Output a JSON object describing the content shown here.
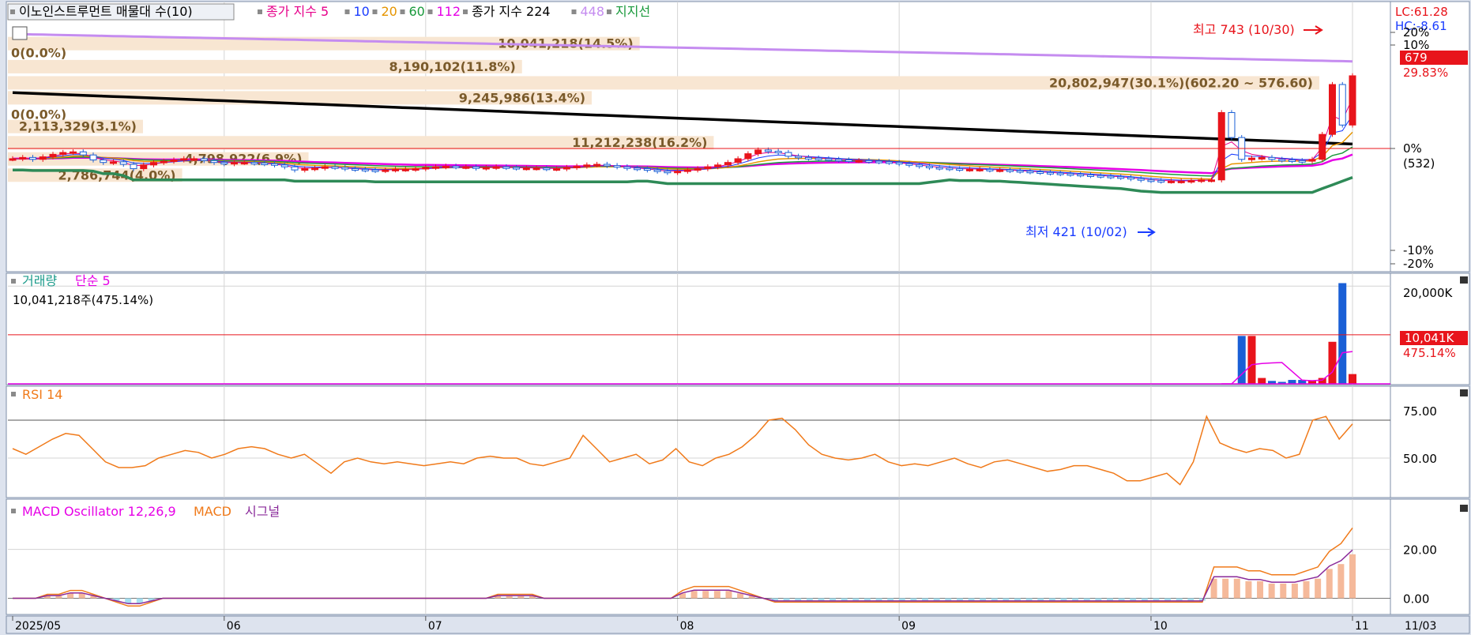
{
  "price_panel": {
    "header_items": [
      {
        "text": "이노인스트루먼트 매물대 수(10)",
        "color": "#000000",
        "boxed": true
      },
      {
        "text": "종가 지수 5",
        "color": "#e6008a"
      },
      {
        "text": "10",
        "color": "#1a3cff"
      },
      {
        "text": "20",
        "color": "#e69500"
      },
      {
        "text": "60",
        "color": "#1a9a3c"
      },
      {
        "text": "112",
        "color": "#e600e6"
      },
      {
        "text": "종가 지수 224",
        "color": "#000000"
      },
      {
        "text": "448",
        "color": "#c58cf0"
      },
      {
        "text": "지지선",
        "color": "#1a9a3c"
      }
    ],
    "lc_label": "LC:61.28",
    "hc_label": "HC:-8.61",
    "price_box_value": "679",
    "price_box_pct": "29.83%",
    "pct_axis_labels": [
      {
        "text": "20%",
        "value": 755
      },
      {
        "text": "10%",
        "value": 718
      },
      {
        "text": "0%",
        "value": 523
      },
      {
        "text": "-10%",
        "value": 398
      },
      {
        "text": "-20%",
        "value": 380
      }
    ],
    "axis_value_label": "(532)",
    "high_label": "최고 743 (10/30)",
    "low_label": "최저 421 (10/02)",
    "volume_profile": [
      {
        "label": "10,041,218(14.5%)",
        "pct": 14.5,
        "level": 730
      },
      {
        "label": "0(0.0%)",
        "pct": 0.0,
        "level": 715
      },
      {
        "label": "8,190,102(11.8%)",
        "pct": 11.8,
        "level": 693
      },
      {
        "label": "20,802,947(30.1%)(602.20 ~ 576.60)",
        "pct": 30.1,
        "level": 667
      },
      {
        "label": "9,245,986(13.4%)",
        "pct": 13.4,
        "level": 643
      },
      {
        "label": "0(0.0%)",
        "pct": 0.0,
        "level": 616
      },
      {
        "label": "2,113,329(3.1%)",
        "pct": 3.1,
        "level": 597
      },
      {
        "label": "11,212,238(16.2%)",
        "pct": 16.2,
        "level": 571
      },
      {
        "label": "4,798,922(6.9%)",
        "pct": 6.9,
        "level": 545
      },
      {
        "label": "2,786,744(4.0%)",
        "pct": 4.0,
        "level": 519
      }
    ]
  },
  "volume_panel": {
    "title": "거래량",
    "ma_label": "단순 5",
    "info": "10,041,218주(475.14%)",
    "axis_top": "20,000K",
    "last_value": "10,041K",
    "last_pct": "475.14%"
  },
  "rsi_panel": {
    "title": "RSI 14",
    "axis_labels": [
      "75.00",
      "50.00"
    ]
  },
  "macd_panel": {
    "title": "MACD Oscillator 12,26,9",
    "macd_label": "MACD",
    "signal_label": "시그널",
    "axis_labels": [
      "20.00",
      "0.00"
    ]
  },
  "x_axis": {
    "labels": [
      {
        "text": "2025/05",
        "index": 0
      },
      {
        "text": "06",
        "index": 21
      },
      {
        "text": "07",
        "index": 41
      },
      {
        "text": "08",
        "index": 66
      },
      {
        "text": "09",
        "index": 88
      },
      {
        "text": "10",
        "index": 113
      },
      {
        "text": "11",
        "index": 133
      }
    ],
    "end_label": "11/03"
  },
  "chart_data": {
    "type": "candlestick",
    "ohlc_close": [
      546,
      548,
      545,
      549,
      553,
      556,
      557,
      552,
      544,
      540,
      541,
      537,
      530,
      536,
      540,
      542,
      544,
      546,
      546,
      543,
      540,
      538,
      540,
      540,
      539,
      538,
      536,
      533,
      528,
      530,
      531,
      533,
      532,
      530,
      529,
      528,
      527,
      528,
      529,
      529,
      530,
      532,
      533,
      534,
      533,
      533,
      531,
      532,
      533,
      532,
      531,
      531,
      531,
      530,
      530,
      532,
      534,
      536,
      537,
      535,
      533,
      531,
      530,
      528,
      526,
      524,
      526,
      528,
      530,
      533,
      536,
      540,
      546,
      554,
      560,
      558,
      556,
      550,
      548,
      547,
      546,
      545,
      544,
      543,
      543,
      542,
      541,
      540,
      538,
      536,
      534,
      532,
      531,
      530,
      529,
      529,
      529,
      528,
      528,
      527,
      526,
      525,
      524,
      523,
      522,
      521,
      520,
      519,
      518,
      517,
      516,
      514,
      512,
      511,
      510,
      510,
      510,
      511,
      512,
      512,
      620,
      580,
      545,
      547,
      548,
      545,
      544,
      543,
      542,
      545,
      585,
      665,
      600,
      679
    ],
    "volume_k": [
      80,
      80,
      0,
      0,
      0,
      0,
      0,
      0,
      0,
      0,
      0,
      0,
      0,
      0,
      0,
      0,
      0,
      0,
      0,
      0,
      0,
      0,
      0,
      0,
      0,
      0,
      0,
      0,
      0,
      0,
      0,
      0,
      0,
      0,
      0,
      0,
      0,
      0,
      0,
      0,
      0,
      0,
      0,
      0,
      0,
      0,
      0,
      0,
      0,
      0,
      0,
      0,
      0,
      0,
      0,
      0,
      0,
      0,
      0,
      0,
      0,
      0,
      0,
      0,
      0,
      0,
      0,
      0,
      0,
      0,
      0,
      0,
      0,
      0,
      0,
      80,
      80,
      0,
      0,
      0,
      0,
      0,
      0,
      0,
      0,
      0,
      0,
      0,
      0,
      0,
      0,
      0,
      0,
      0,
      0,
      0,
      0,
      0,
      0,
      0,
      0,
      0,
      0,
      0,
      0,
      0,
      0,
      0,
      0,
      0,
      0,
      0,
      0,
      0,
      0,
      0,
      0,
      0,
      0,
      0,
      0,
      0,
      0,
      0,
      0,
      0,
      0,
      0,
      0,
      0,
      0,
      0,
      0,
      0,
      0,
      0,
      0,
      0,
      0,
      0,
      0,
      0,
      0,
      0
    ],
    "volume_last12_k": [
      9800,
      9800,
      1200,
      600,
      400,
      800,
      800,
      600,
      1200,
      8600,
      20600,
      2000
    ],
    "rsi": [
      55,
      52,
      56,
      60,
      63,
      62,
      55,
      48,
      45,
      45,
      46,
      50,
      52,
      54,
      53,
      50,
      52,
      55,
      56,
      55,
      52,
      50,
      52,
      47,
      42,
      48,
      50,
      48,
      47,
      48,
      47,
      46,
      47,
      48,
      47,
      50,
      51,
      50,
      50,
      47,
      46,
      48,
      50,
      62,
      55,
      48,
      50,
      52,
      47,
      49,
      55,
      48,
      46,
      50,
      52,
      56,
      62,
      70,
      71,
      65,
      57,
      52,
      50,
      49,
      50,
      52,
      48,
      46,
      47,
      46,
      48,
      50,
      47,
      45,
      48,
      49,
      47,
      45,
      43,
      44,
      46,
      46,
      44,
      42,
      38,
      38,
      40,
      42,
      36,
      48,
      72,
      58,
      55,
      53,
      55,
      54,
      50,
      52,
      70,
      72,
      60,
      68
    ],
    "macd_osc": [
      0,
      0,
      0,
      1,
      1,
      2,
      2,
      1,
      0,
      -1,
      -2,
      -2,
      -1,
      0,
      0,
      0,
      0,
      0,
      0,
      0,
      0,
      0,
      0,
      0,
      0,
      0,
      0,
      0,
      0,
      0,
      0,
      0,
      0,
      0,
      0,
      0,
      0,
      0,
      0,
      0,
      0,
      0,
      1,
      1,
      1,
      1,
      0,
      0,
      0,
      0,
      0,
      0,
      0,
      0,
      0,
      0,
      0,
      0,
      2,
      3,
      3,
      3,
      3,
      2,
      1,
      0,
      -1,
      -1,
      -1,
      -1,
      -1,
      -1,
      -1,
      -1,
      -1,
      -1,
      -1,
      -1,
      -1,
      -1,
      -1,
      -1,
      -1,
      -1,
      -1,
      -1,
      -1,
      -1,
      -1,
      -1,
      -1,
      -1,
      -1,
      -1,
      -1,
      -1,
      -1,
      -1,
      -1,
      -1,
      -1,
      -1,
      -1,
      -1,
      8,
      8,
      8,
      7,
      7,
      6,
      6,
      6,
      7,
      8,
      12,
      14,
      18
    ],
    "rsi_ylim": [
      30,
      85
    ],
    "macd_ylim": [
      -6,
      38
    ]
  }
}
